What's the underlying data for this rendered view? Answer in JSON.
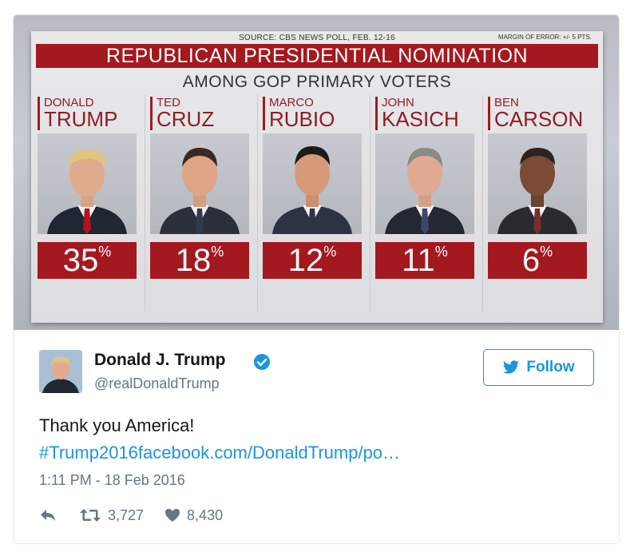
{
  "graphic": {
    "source": "SOURCE: CBS NEWS POLL, FEB. 12-16",
    "margin": "MARGIN OF ERROR: +/- 5 PTS.",
    "title": "REPUBLICAN PRESIDENTIAL NOMINATION",
    "subtitle": "AMONG GOP PRIMARY VOTERS",
    "candidates": [
      {
        "first": "DONALD",
        "last": "TRUMP",
        "pct": "35",
        "tie": "#b3131b"
      },
      {
        "first": "TED",
        "last": "CRUZ",
        "pct": "18",
        "tie": "#2f3a52"
      },
      {
        "first": "MARCO",
        "last": "RUBIO",
        "pct": "12",
        "tie": "#2c3443"
      },
      {
        "first": "JOHN",
        "last": "KASICH",
        "pct": "11",
        "tie": "#3a4a66"
      },
      {
        "first": "BEN",
        "last": "CARSON",
        "pct": "6",
        "tie": "#7a2c2c"
      }
    ],
    "percent_sign": "%"
  },
  "tweet": {
    "display_name": "Donald J. Trump",
    "handle": "@realDonaldTrump",
    "follow_label": "Follow",
    "text": "Thank you America!",
    "link": "#Trump2016facebook.com/DonaldTrump/po…",
    "timestamp": "1:11 PM - 18 Feb 2016",
    "retweets": "3,727",
    "likes": "8,430"
  },
  "colors": {
    "accent": "#1b95e0",
    "banner_red": "#a3191f"
  }
}
